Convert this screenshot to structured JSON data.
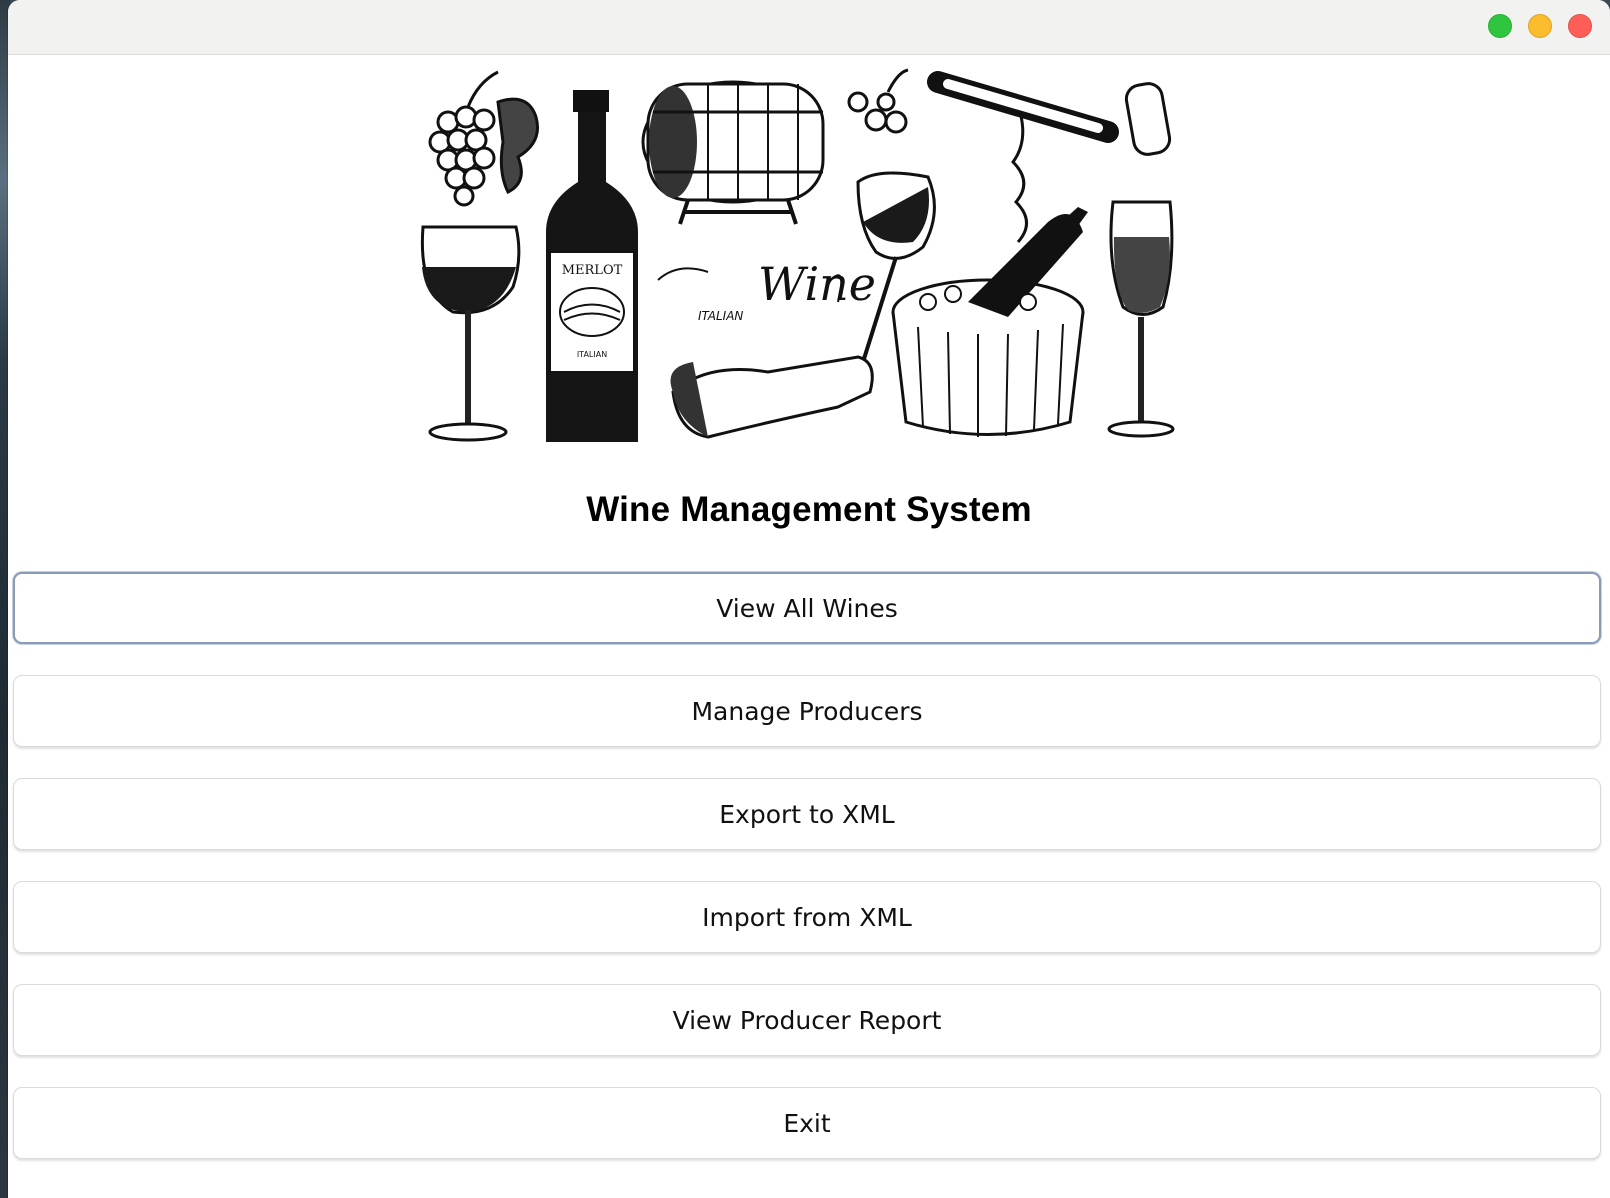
{
  "window": {
    "controls": [
      "green-dot",
      "yellow-dot",
      "red-dot"
    ]
  },
  "banner": {
    "bottle_label": "MERLOT",
    "bottle_sub": "ITALIAN",
    "script_text": "Wine",
    "script_sub": "ITALIAN"
  },
  "app": {
    "title": "Wine Management System"
  },
  "menu": [
    {
      "label": "View All Wines"
    },
    {
      "label": "Manage Producers"
    },
    {
      "label": "Export to XML"
    },
    {
      "label": "Import from XML"
    },
    {
      "label": "View Producer Report"
    },
    {
      "label": "Exit"
    }
  ],
  "colors": {
    "accent_focus": "#8a9bb5",
    "green": "#2fc53f",
    "yellow": "#fbbc2e",
    "red": "#fe5e57"
  }
}
